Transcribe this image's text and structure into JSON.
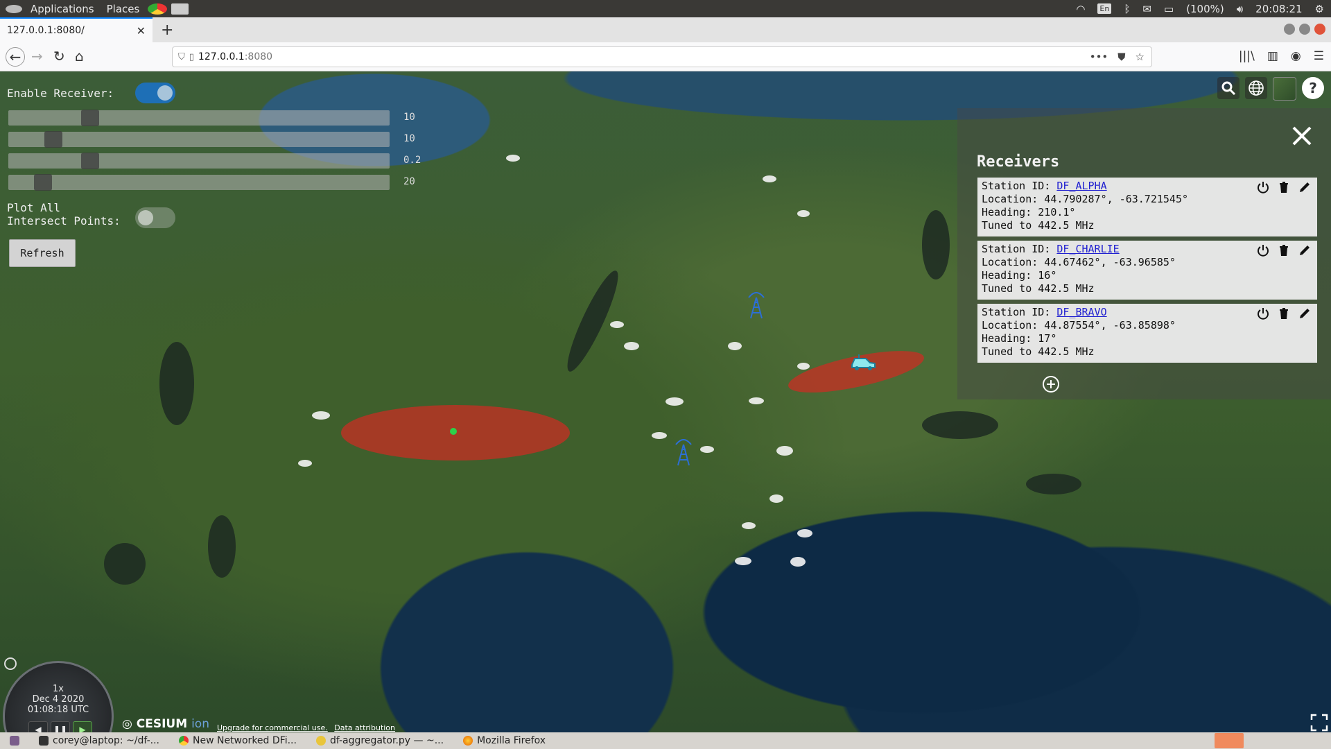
{
  "os": {
    "menu_applications": "Applications",
    "menu_places": "Places",
    "keyboard_layout": "En",
    "battery": "(100%)",
    "clock": "20:08:21"
  },
  "browser": {
    "tab_title": "127.0.0.1:8080/",
    "url_host": "127.0.0.1",
    "url_port": ":8080"
  },
  "controls": {
    "enable_receiver_label": "Enable Receiver:",
    "enable_receiver_on": true,
    "sliders": [
      {
        "value": "10",
        "position": 0.2
      },
      {
        "value": "10",
        "position": 0.1
      },
      {
        "value": "0.2",
        "position": 0.2
      },
      {
        "value": "20",
        "position": 0.07
      }
    ],
    "plot_all_label_1": "Plot All",
    "plot_all_label_2": "Intersect Points:",
    "plot_all_on": false,
    "refresh_label": "Refresh"
  },
  "receivers": {
    "title": "Receivers",
    "items": [
      {
        "id_label": "Station ID:",
        "id": "DF_ALPHA",
        "location": "Location: 44.790287°, -63.721545°",
        "heading": "Heading: 210.1°",
        "tuned": "Tuned to 442.5 MHz"
      },
      {
        "id_label": "Station ID:",
        "id": "DF_CHARLIE",
        "location": "Location: 44.67462°, -63.96585°",
        "heading": "Heading: 16°",
        "tuned": "Tuned to 442.5 MHz"
      },
      {
        "id_label": "Station ID:",
        "id": "DF_BRAVO",
        "location": "Location: 44.87554°, -63.85898°",
        "heading": "Heading: 17°",
        "tuned": "Tuned to 442.5 MHz"
      }
    ]
  },
  "clock_widget": {
    "speed": "1x",
    "date": "Dec 4 2020",
    "time": "01:08:18 UTC"
  },
  "cesium": {
    "logo_main": "CESIUM",
    "logo_ion": "ion",
    "credit_upgrade": "Upgrade for commercial use.",
    "credit_attribution": "Data attribution"
  },
  "taskbar": {
    "items": [
      "corey@laptop: ~/df-...",
      "New Networked DFi...",
      "df-aggregator.py — ~...",
      "Mozilla Firefox"
    ]
  },
  "colors": {
    "accent_blue": "#1e6fb6",
    "intersect_red": "#cd2d23",
    "link_blue": "#2020d0"
  }
}
